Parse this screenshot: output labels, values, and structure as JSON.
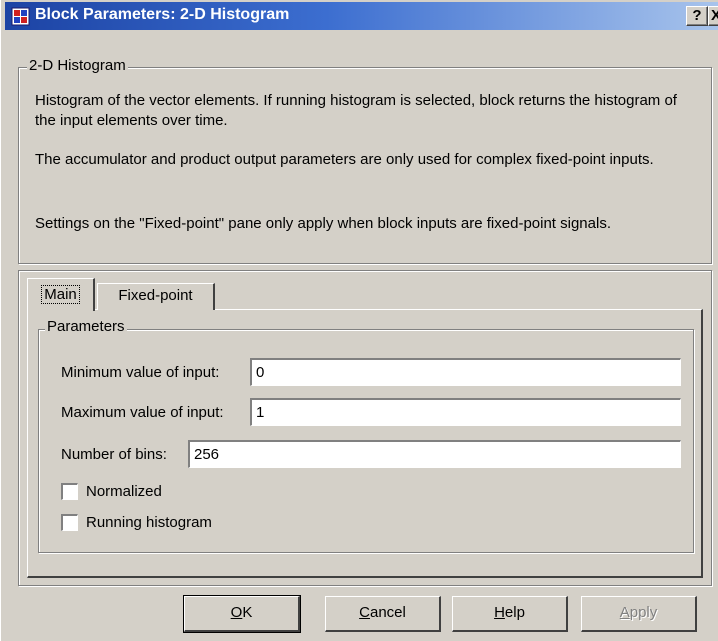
{
  "window": {
    "title": "Block Parameters: 2-D Histogram",
    "help_glyph": "?",
    "close_glyph": "X"
  },
  "description": {
    "group_title": "2-D Histogram",
    "paragraphs": [
      "Histogram of the vector elements.  If running histogram is selected, block returns the histogram of the input elements over time.",
      "The accumulator and product output parameters are only used for complex fixed-point inputs.",
      "Settings on the \"Fixed-point\" pane only apply when block inputs are fixed-point signals."
    ]
  },
  "tabs": [
    {
      "label": "Main",
      "active": true
    },
    {
      "label": "Fixed-point",
      "active": false
    }
  ],
  "parameters": {
    "group_title": "Parameters",
    "min_input": {
      "label": "Minimum value of input:",
      "value": "0"
    },
    "max_input": {
      "label": "Maximum value of input:",
      "value": "1"
    },
    "num_bins": {
      "label": "Number of bins:",
      "value": "256"
    },
    "normalized": {
      "label": "Normalized",
      "checked": false
    },
    "running_histogram": {
      "label": "Running histogram",
      "checked": false
    }
  },
  "buttons": {
    "ok": {
      "mnemonic": "O",
      "rest": "K"
    },
    "cancel": {
      "mnemonic": "C",
      "rest": "ancel"
    },
    "help": {
      "mnemonic": "H",
      "rest": "elp"
    },
    "apply": {
      "mnemonic": "A",
      "rest": "pply",
      "disabled": true
    }
  }
}
